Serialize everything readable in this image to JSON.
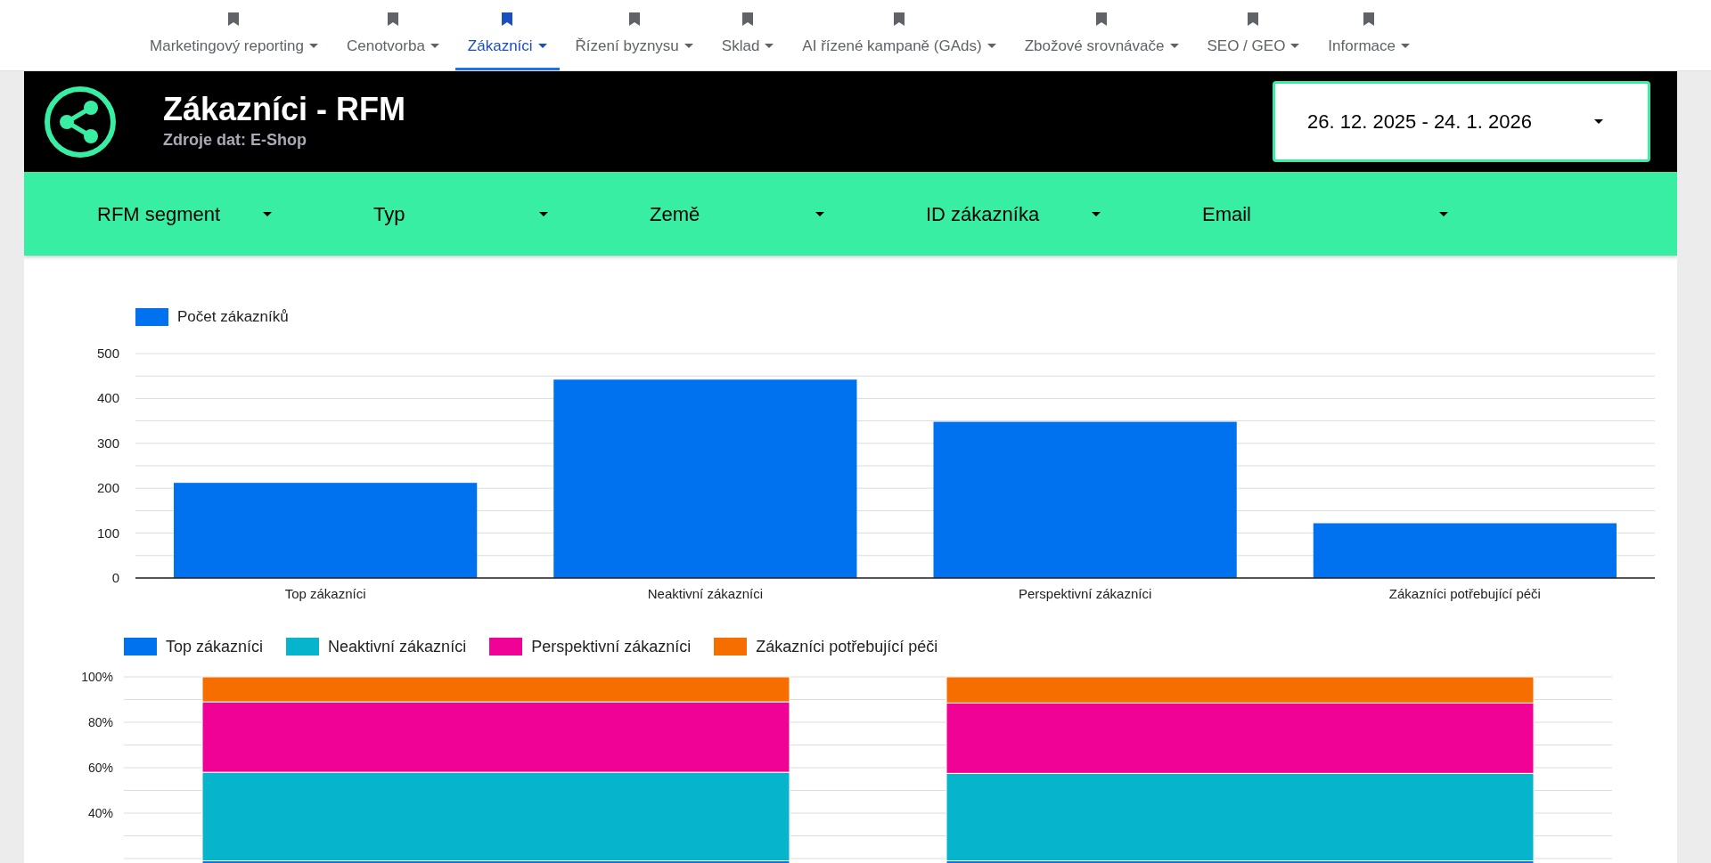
{
  "nav": {
    "items": [
      {
        "label": "Marketingový reporting",
        "selected": false
      },
      {
        "label": "Cenotvorba",
        "selected": false
      },
      {
        "label": "Zákazníci",
        "selected": true
      },
      {
        "label": "Řízení byznysu",
        "selected": false
      },
      {
        "label": "Sklad",
        "selected": false
      },
      {
        "label": "AI řízené kampaně (GAds)",
        "selected": false
      },
      {
        "label": "Zbožové srovnávače",
        "selected": false
      },
      {
        "label": "SEO / GEO",
        "selected": false
      },
      {
        "label": "Informace",
        "selected": false
      }
    ]
  },
  "header": {
    "title": "Zákazníci - RFM",
    "subtitle": "Zdroje dat: E-Shop",
    "date_range": "26. 12. 2025 - 24. 1. 2026"
  },
  "filters": [
    {
      "label": "RFM segment"
    },
    {
      "label": "Typ"
    },
    {
      "label": "Země"
    },
    {
      "label": "ID zákazníka"
    },
    {
      "label": "Email"
    }
  ],
  "bar_chart": {
    "chart_data": {
      "type": "bar",
      "categories": [
        "Top zákazníci",
        "Neaktivní zákazníci",
        "Perspektivní zákazníci",
        "Zákazníci potřebující péči"
      ],
      "series": [
        {
          "name": "Počet zákazníků",
          "color": "#0072f0",
          "values": [
            212,
            442,
            348,
            122
          ]
        }
      ],
      "ylim": [
        0,
        500
      ],
      "yticks": [
        0,
        100,
        200,
        300,
        400,
        500
      ],
      "grid": true
    }
  },
  "stacked_chart": {
    "chart_data": {
      "type": "bar",
      "stacked": true,
      "series": [
        {
          "name": "Top zákazníci",
          "color": "#0072f0",
          "values": [
            19,
            19
          ]
        },
        {
          "name": "Neaktivní zákazníci",
          "color": "#06b4cb",
          "values": [
            39,
            38.5
          ]
        },
        {
          "name": "Perspektivní zákazníci",
          "color": "#f10296",
          "values": [
            31,
            31
          ]
        },
        {
          "name": "Zákazníci potřebující péči",
          "color": "#f66d00",
          "values": [
            11,
            11.5
          ]
        }
      ],
      "ylim": [
        0,
        100
      ],
      "grid": true,
      "yticks": [
        {
          "value": 40,
          "label": "40%"
        },
        {
          "value": 60,
          "label": "60%"
        },
        {
          "value": 80,
          "label": "80%"
        },
        {
          "value": 100,
          "label": "100%"
        }
      ]
    }
  }
}
